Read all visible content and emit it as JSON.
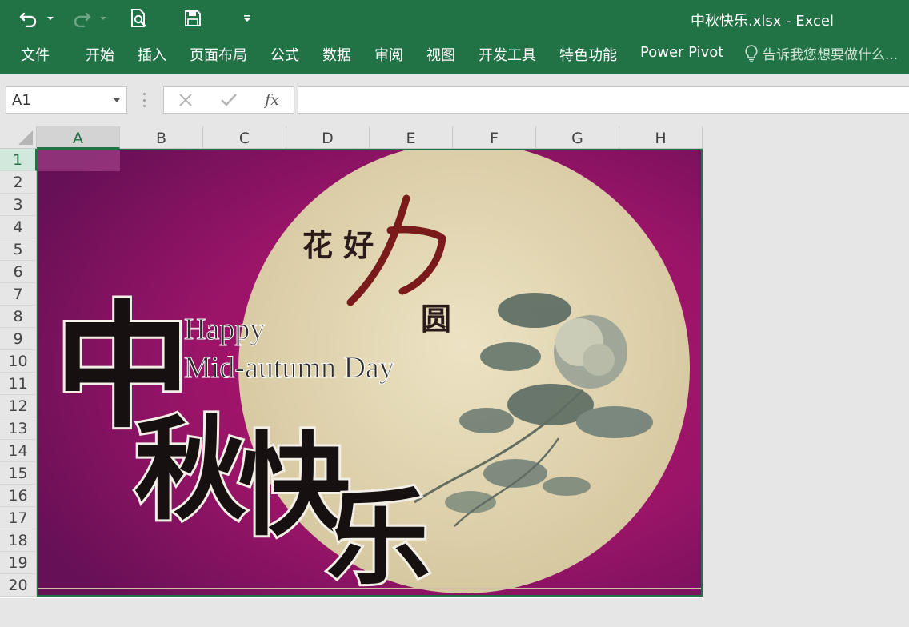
{
  "window": {
    "title": "中秋快乐.xlsx - Excel"
  },
  "quick_access": [
    {
      "name": "undo-icon"
    },
    {
      "name": "undo-dropdown-icon"
    },
    {
      "name": "redo-icon"
    },
    {
      "name": "redo-dropdown-icon"
    },
    {
      "name": "print-preview-icon"
    },
    {
      "name": "save-icon"
    },
    {
      "name": "customize-toolbar-icon"
    }
  ],
  "ribbon": {
    "tabs": [
      "文件",
      "开始",
      "插入",
      "页面布局",
      "公式",
      "数据",
      "审阅",
      "视图",
      "开发工具",
      "特色功能",
      "Power Pivot"
    ],
    "tell_me": "告诉我您想要做什么..."
  },
  "formula_bar": {
    "name_box": "A1",
    "fx_label": "fx",
    "formula_value": ""
  },
  "grid": {
    "columns": [
      "A",
      "B",
      "C",
      "D",
      "E",
      "F",
      "G",
      "H"
    ],
    "rows": [
      "1",
      "2",
      "3",
      "4",
      "5",
      "6",
      "7",
      "8",
      "9",
      "10",
      "11",
      "12",
      "13",
      "14",
      "15",
      "16",
      "17",
      "18",
      "19",
      "20"
    ],
    "selected_cell": "A1"
  },
  "picture": {
    "title_cn": "中秋快乐",
    "subtitle_cn": "花好月圆",
    "greeting_line1": "Happy",
    "greeting_line2": "Mid-autumn Day"
  },
  "colors": {
    "ribbon_green": "#217346",
    "background_magenta": "#a3156a",
    "moon": "#e4d8b3"
  }
}
